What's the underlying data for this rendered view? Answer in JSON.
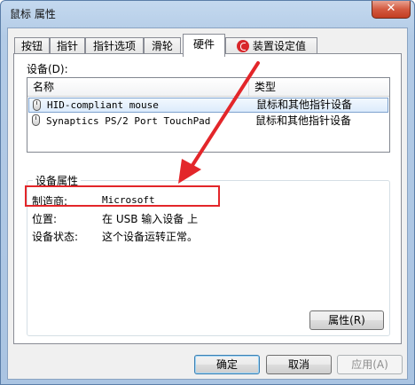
{
  "window": {
    "title": "鼠标 属性",
    "close_glyph": "✕"
  },
  "tabs": [
    {
      "label": "按钮",
      "active": false
    },
    {
      "label": "指针",
      "active": false
    },
    {
      "label": "指针选项",
      "active": false
    },
    {
      "label": "滑轮",
      "active": false
    },
    {
      "label": "硬件",
      "active": true
    },
    {
      "label": "装置设定值",
      "active": false
    }
  ],
  "devices": {
    "label": "设备(D):",
    "columns": [
      "名称",
      "类型"
    ],
    "rows": [
      {
        "name": "HID-compliant mouse",
        "type": "鼠标和其他指针设备",
        "selected": true,
        "icon": "mouse-icon"
      },
      {
        "name": "Synaptics PS/2 Port TouchPad",
        "type": "鼠标和其他指针设备",
        "selected": false,
        "icon": "mouse-icon"
      }
    ]
  },
  "properties": {
    "legend": "设备属性",
    "manufacturer_label": "制造商:",
    "manufacturer_value": "Microsoft",
    "location_label": "位置:",
    "location_value": "在 USB 输入设备 上",
    "status_label": "设备状态:",
    "status_value": "这个设备运转正常。",
    "properties_button": "属性(R)"
  },
  "buttons": {
    "ok": "确定",
    "cancel": "取消",
    "apply": "应用(A)"
  },
  "colors": {
    "annotation": "#e3262a",
    "titlebar": "#b3cbe6"
  }
}
